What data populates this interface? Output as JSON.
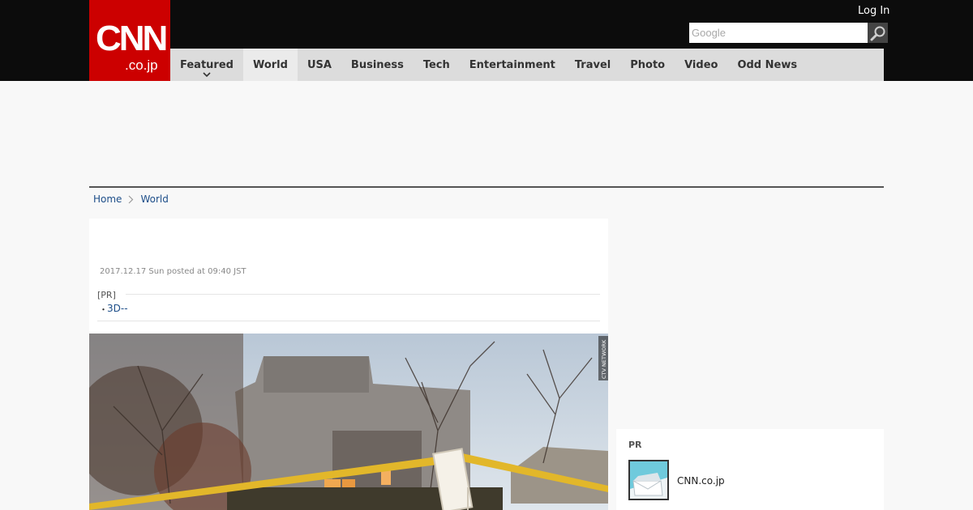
{
  "brand": {
    "logo_main": "CNN",
    "logo_sub": ".co.jp",
    "red": "#cc0000",
    "header_bg": "#0c0c0c",
    "nav_bg": "#dcdcdc",
    "link": "#1d4e89"
  },
  "header": {
    "login_label": "Log In",
    "search_placeholder": "Google",
    "search_icon": "magnifier-icon"
  },
  "nav": {
    "items": [
      {
        "label": "Featured",
        "has_dropdown": true
      },
      {
        "label": "World",
        "active": true
      },
      {
        "label": "USA"
      },
      {
        "label": "Business"
      },
      {
        "label": "Tech"
      },
      {
        "label": "Entertainment"
      },
      {
        "label": "Travel"
      },
      {
        "label": "Photo"
      },
      {
        "label": "Video"
      },
      {
        "label": "Odd News"
      }
    ]
  },
  "breadcrumb": {
    "items": [
      "Home",
      "World"
    ],
    "separator_icon": "chevron-right-icon"
  },
  "article": {
    "posted": "2017.12.17 Sun posted at 09:40 JST",
    "pr_label": "[PR]",
    "pr_bullet": "・",
    "pr_link": "3D--",
    "photo_watermark": "CTV NETWORK"
  },
  "sidebar": {
    "pr_title": "PR",
    "pr_item_name": "CNN.co.jp",
    "pr_item_icon": "mail-envelope-icon"
  }
}
